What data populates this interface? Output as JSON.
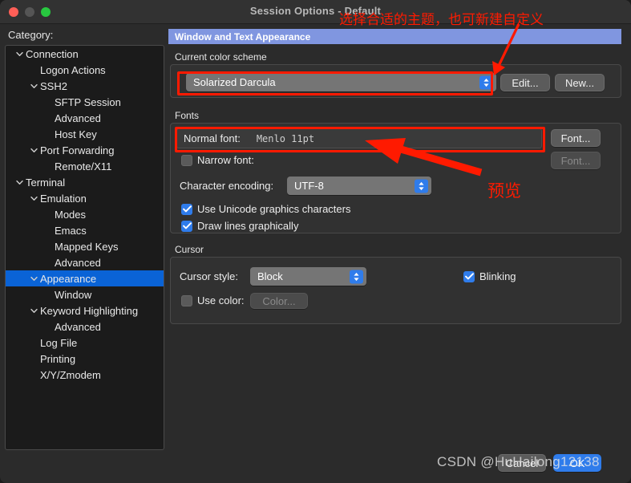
{
  "window": {
    "title": "Session Options - Default",
    "traffic_lights": [
      "close",
      "minimize",
      "maximize"
    ]
  },
  "sidebar": {
    "label": "Category:",
    "items": [
      {
        "label": "Connection",
        "depth": 0,
        "twisty": "down",
        "selected": false
      },
      {
        "label": "Logon Actions",
        "depth": 1,
        "twisty": "none",
        "selected": false
      },
      {
        "label": "SSH2",
        "depth": 1,
        "twisty": "down",
        "selected": false
      },
      {
        "label": "SFTP Session",
        "depth": 2,
        "twisty": "none",
        "selected": false
      },
      {
        "label": "Advanced",
        "depth": 2,
        "twisty": "none",
        "selected": false
      },
      {
        "label": "Host Key",
        "depth": 2,
        "twisty": "none",
        "selected": false
      },
      {
        "label": "Port Forwarding",
        "depth": 1,
        "twisty": "down",
        "selected": false
      },
      {
        "label": "Remote/X11",
        "depth": 2,
        "twisty": "none",
        "selected": false
      },
      {
        "label": "Terminal",
        "depth": 0,
        "twisty": "down",
        "selected": false
      },
      {
        "label": "Emulation",
        "depth": 1,
        "twisty": "down",
        "selected": false
      },
      {
        "label": "Modes",
        "depth": 2,
        "twisty": "none",
        "selected": false
      },
      {
        "label": "Emacs",
        "depth": 2,
        "twisty": "none",
        "selected": false
      },
      {
        "label": "Mapped Keys",
        "depth": 2,
        "twisty": "none",
        "selected": false
      },
      {
        "label": "Advanced",
        "depth": 2,
        "twisty": "none",
        "selected": false
      },
      {
        "label": "Appearance",
        "depth": 1,
        "twisty": "down",
        "selected": true
      },
      {
        "label": "Window",
        "depth": 2,
        "twisty": "none",
        "selected": false
      },
      {
        "label": "Keyword Highlighting",
        "depth": 1,
        "twisty": "down",
        "selected": false
      },
      {
        "label": "Advanced",
        "depth": 2,
        "twisty": "none",
        "selected": false
      },
      {
        "label": "Log File",
        "depth": 1,
        "twisty": "none",
        "selected": false
      },
      {
        "label": "Printing",
        "depth": 1,
        "twisty": "none",
        "selected": false
      },
      {
        "label": "X/Y/Zmodem",
        "depth": 1,
        "twisty": "none",
        "selected": false
      }
    ]
  },
  "panel": {
    "header": "Window and Text Appearance",
    "color_scheme": {
      "group_label": "Current color scheme",
      "selected": "Solarized Darcula",
      "edit_button": "Edit...",
      "new_button": "New..."
    },
    "fonts": {
      "group_label": "Fonts",
      "normal_font_label": "Normal font:",
      "normal_font_value": "Menlo 11pt",
      "normal_font_button": "Font...",
      "narrow_font_label": "Narrow font:",
      "narrow_font_checked": false,
      "narrow_font_button": "Font...",
      "encoding_label": "Character encoding:",
      "encoding_value": "UTF-8",
      "unicode_graphics_label": "Use Unicode graphics characters",
      "unicode_graphics_checked": true,
      "draw_lines_label": "Draw lines graphically",
      "draw_lines_checked": true
    },
    "cursor": {
      "group_label": "Cursor",
      "style_label": "Cursor style:",
      "style_value": "Block",
      "blinking_label": "Blinking",
      "blinking_checked": true,
      "use_color_label": "Use color:",
      "use_color_checked": false,
      "color_button": "Color..."
    }
  },
  "footer": {
    "cancel_button": "Cancel",
    "ok_button": "OK"
  },
  "annotations": {
    "theme_note": "选择合适的主题，也可新建自定义",
    "preview_note": "预览",
    "color": "#ff1a00"
  },
  "watermark": "CSDN @HuHailong12138"
}
